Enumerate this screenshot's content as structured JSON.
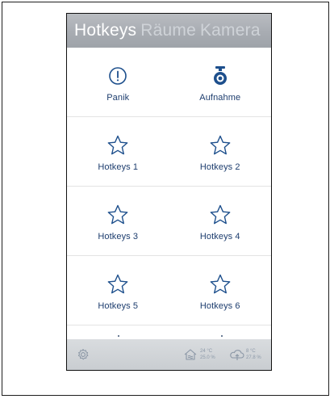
{
  "tabs": [
    {
      "label": "Hotkeys",
      "active": true
    },
    {
      "label": "Räume",
      "active": false
    },
    {
      "label": "Kamera",
      "active": false
    }
  ],
  "tiles": [
    {
      "label": "Panik",
      "icon": "alert-circle-icon"
    },
    {
      "label": "Aufnahme",
      "icon": "camera-icon"
    },
    {
      "label": "Hotkeys 1",
      "icon": "star-icon"
    },
    {
      "label": "Hotkeys 2",
      "icon": "star-icon"
    },
    {
      "label": "Hotkeys 3",
      "icon": "star-icon"
    },
    {
      "label": "Hotkeys 4",
      "icon": "star-icon"
    },
    {
      "label": "Hotkeys 5",
      "icon": "star-icon"
    },
    {
      "label": "Hotkeys 6",
      "icon": "star-icon"
    }
  ],
  "bottombar": {
    "settings_icon": "gear-icon",
    "indoor": {
      "icon": "house-climate-icon",
      "temperature": "24 °C",
      "humidity": "25.0 %"
    },
    "outdoor": {
      "icon": "cloud-sun-icon",
      "temperature": "8 °C",
      "humidity": "27.8 %"
    }
  },
  "colors": {
    "label": "#1d3d6e",
    "icon": "#1d4f8c",
    "topbar": "#a8acb2",
    "bottombar": "#cfd3d6"
  }
}
